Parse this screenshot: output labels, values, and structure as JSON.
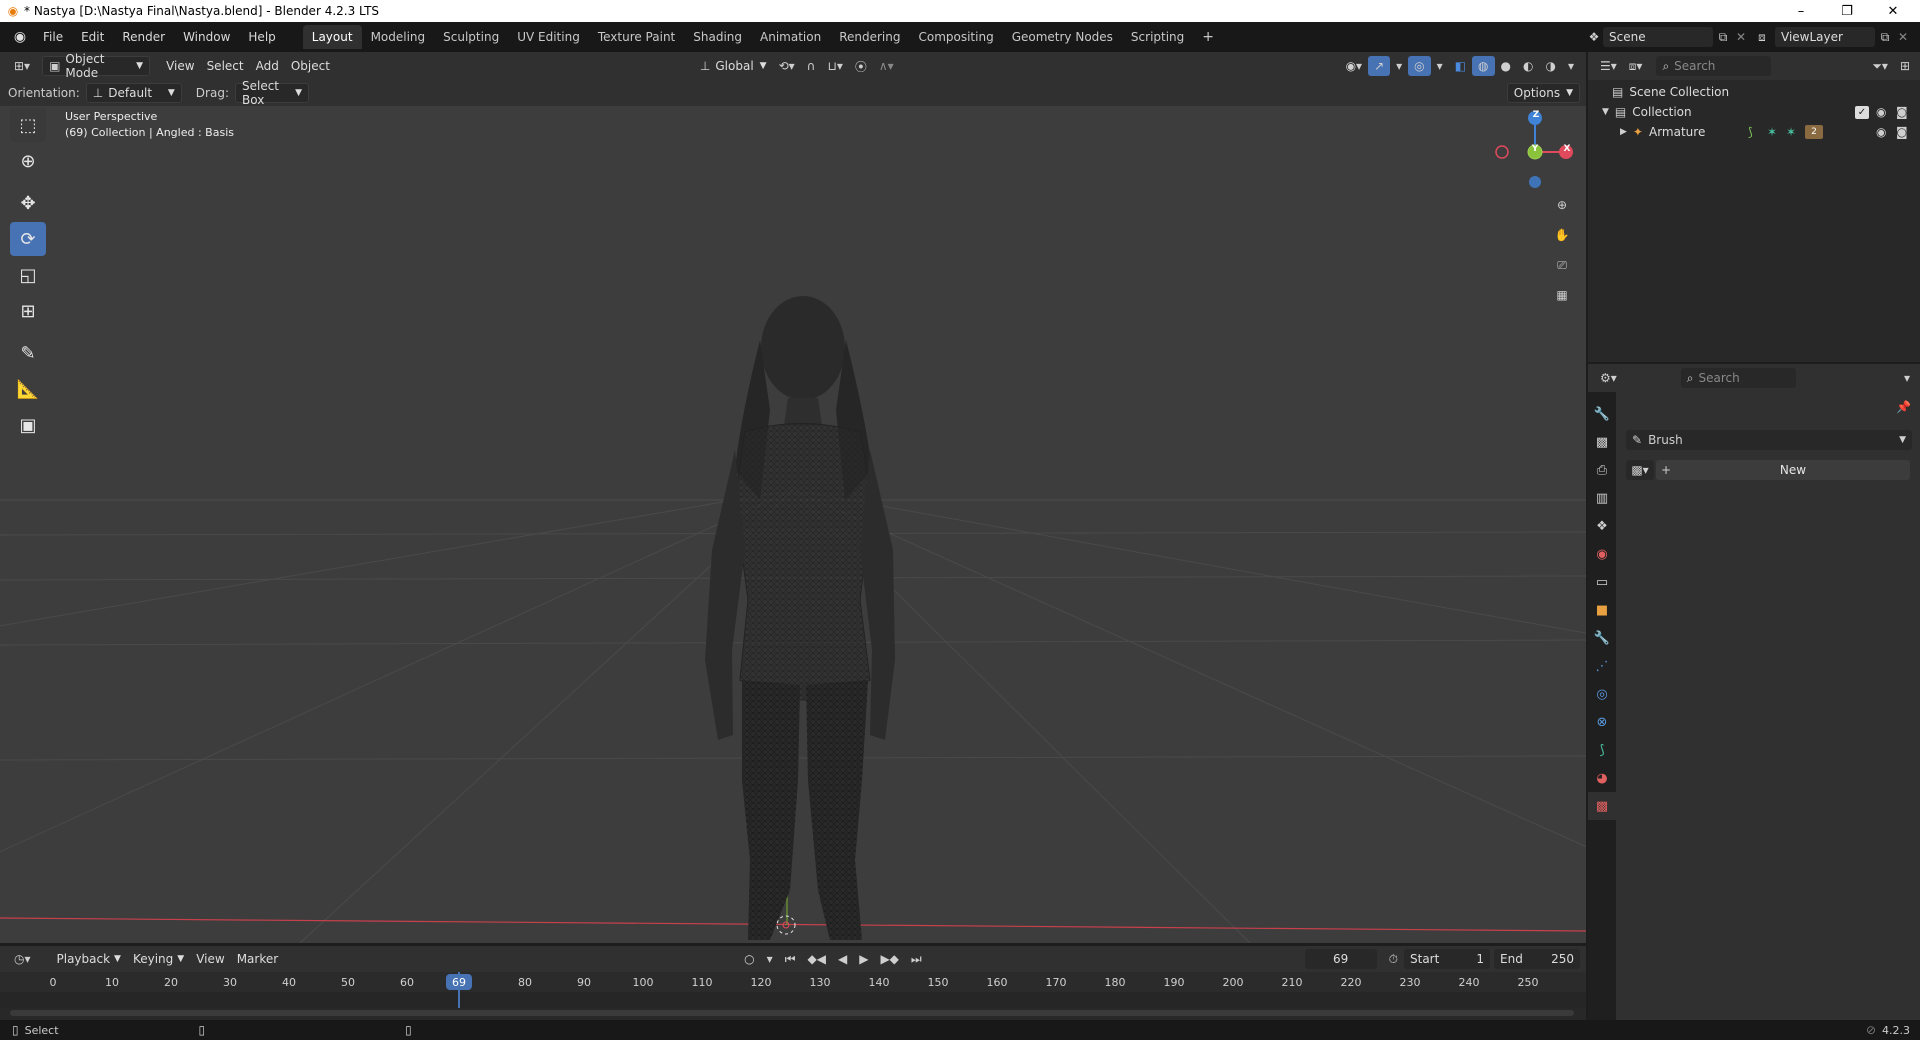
{
  "window": {
    "title": "* Nastya [D:\\Nastya Final\\Nastya.blend] - Blender 4.2.3 LTS",
    "controls": {
      "minimize": "–",
      "maximize": "❐",
      "close": "✕"
    }
  },
  "menu": {
    "items": [
      "File",
      "Edit",
      "Render",
      "Window",
      "Help"
    ]
  },
  "workspaces": {
    "tabs": [
      "Layout",
      "Modeling",
      "Sculpting",
      "UV Editing",
      "Texture Paint",
      "Shading",
      "Animation",
      "Rendering",
      "Compositing",
      "Geometry Nodes",
      "Scripting"
    ],
    "active": "Layout",
    "add_label": "+"
  },
  "scene": {
    "name": "Scene",
    "view_layer": "ViewLayer"
  },
  "viewport_header": {
    "mode": "Object Mode",
    "menus": [
      "View",
      "Select",
      "Add",
      "Object"
    ],
    "transform_orientation": "Global"
  },
  "tool_options": {
    "orientation_label": "Orientation:",
    "orientation_value": "Default",
    "drag_label": "Drag:",
    "drag_value": "Select Box",
    "options_label": "Options"
  },
  "viewport": {
    "view_name": "User Perspective",
    "context": "(69) Collection | Angled : Basis",
    "gizmo": {
      "x": "X",
      "y": "Y",
      "z": "Z"
    }
  },
  "tools": [
    "select-box-tool",
    "cursor-tool",
    "move-tool",
    "rotate-tool",
    "scale-tool",
    "transform-tool",
    "annotate-tool",
    "measure-tool",
    "add-cube-tool"
  ],
  "outliner": {
    "search_placeholder": "Search",
    "root": "Scene Collection",
    "collection": "Collection",
    "object": "Armature",
    "modifier_count": "2"
  },
  "properties": {
    "search_placeholder": "Search",
    "brush_label": "Brush",
    "new_label": "New"
  },
  "timeline": {
    "menus": [
      "Playback",
      "Keying",
      "View",
      "Marker"
    ],
    "current_frame": "69",
    "start_label": "Start",
    "start_value": "1",
    "end_label": "End",
    "end_value": "250",
    "ticks": [
      "0",
      "10",
      "20",
      "30",
      "40",
      "50",
      "60",
      "69",
      "80",
      "90",
      "100",
      "110",
      "120",
      "130",
      "140",
      "150",
      "160",
      "170",
      "180",
      "190",
      "200",
      "210",
      "220",
      "230",
      "240",
      "250"
    ]
  },
  "statusbar": {
    "left": "Select",
    "version": "4.2.3"
  },
  "colors": {
    "accent": "#4772b3",
    "x_axis": "#e04a5c",
    "y_axis": "#8bc23c",
    "z_axis": "#3f82d6",
    "viewport_bg": "#3d3d3d"
  }
}
